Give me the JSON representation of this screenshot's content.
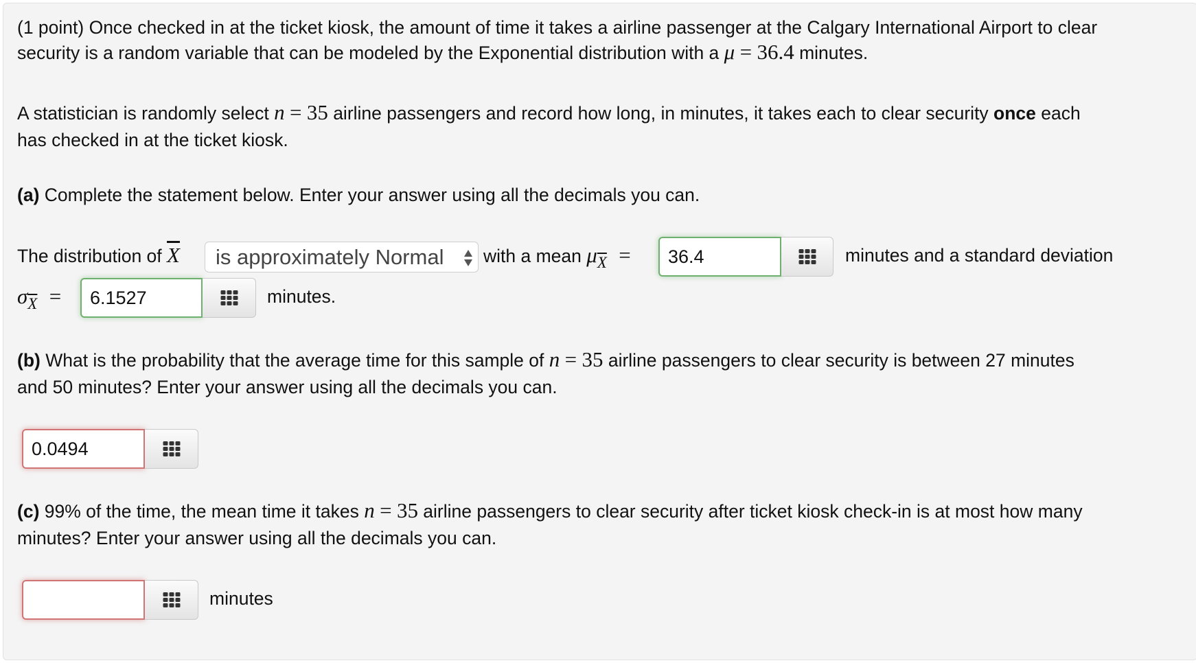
{
  "problem": {
    "intro_line1": "(1 point) Once checked in at the ticket kiosk, the amount of time it takes a airline passenger at the Calgary International Airport to clear",
    "intro_line2_pre": "security is a random variable that can be modeled by the Exponential distribution with a ",
    "mu_symbol": "μ",
    "equals": "=",
    "mu_value": "36.4",
    "intro_line2_post": " minutes.",
    "para2_line1_pre": "A statistician is randomly select ",
    "n_symbol": "n",
    "n_value": "35",
    "para2_line1_post": " airline passengers and record how long, in minutes, it takes each to clear security ",
    "para2_bold": "once",
    "para2_line1_end": " each",
    "para2_line2": "has checked in at the ticket kiosk."
  },
  "part_a": {
    "label": "(a)",
    "instruction": " Complete the statement below. Enter your answer using all the decimals you can.",
    "text_pre": "The distribution of ",
    "xbar": "X",
    "select_value": "is approximately Normal",
    "text_mean": " with a mean ",
    "mu_sub_symbol": "μ",
    "mean_answer": "36.4",
    "mean_status": "correct",
    "text_sd": "minutes and a standard deviation",
    "sigma_symbol": "σ",
    "sd_answer": "6.1527",
    "sd_status": "correct",
    "text_end": "minutes."
  },
  "part_b": {
    "label": "(b)",
    "line1_pre": " What is the probability that the average time for this sample of ",
    "line1_post": " airline passengers to clear security is between 27 minutes",
    "line2": "and 50 minutes? Enter your answer using all the decimals you can.",
    "answer": "0.0494",
    "status": "incorrect"
  },
  "part_c": {
    "label": "(c)",
    "line1_pre": " 99% of the time, the mean time it takes ",
    "line1_post": " airline passengers to clear security after ticket kiosk check-in is at most how many",
    "line2": "minutes? Enter your answer using all the decimals you can.",
    "answer": "",
    "status": "incorrect",
    "unit": "minutes"
  },
  "icons": {
    "keypad": "keypad-grid-icon",
    "select_arrows": "up-down-arrows-icon"
  },
  "colors": {
    "correct_border": "#6fb06f",
    "incorrect_border": "#d07575",
    "panel_bg": "#f4f4f4"
  }
}
